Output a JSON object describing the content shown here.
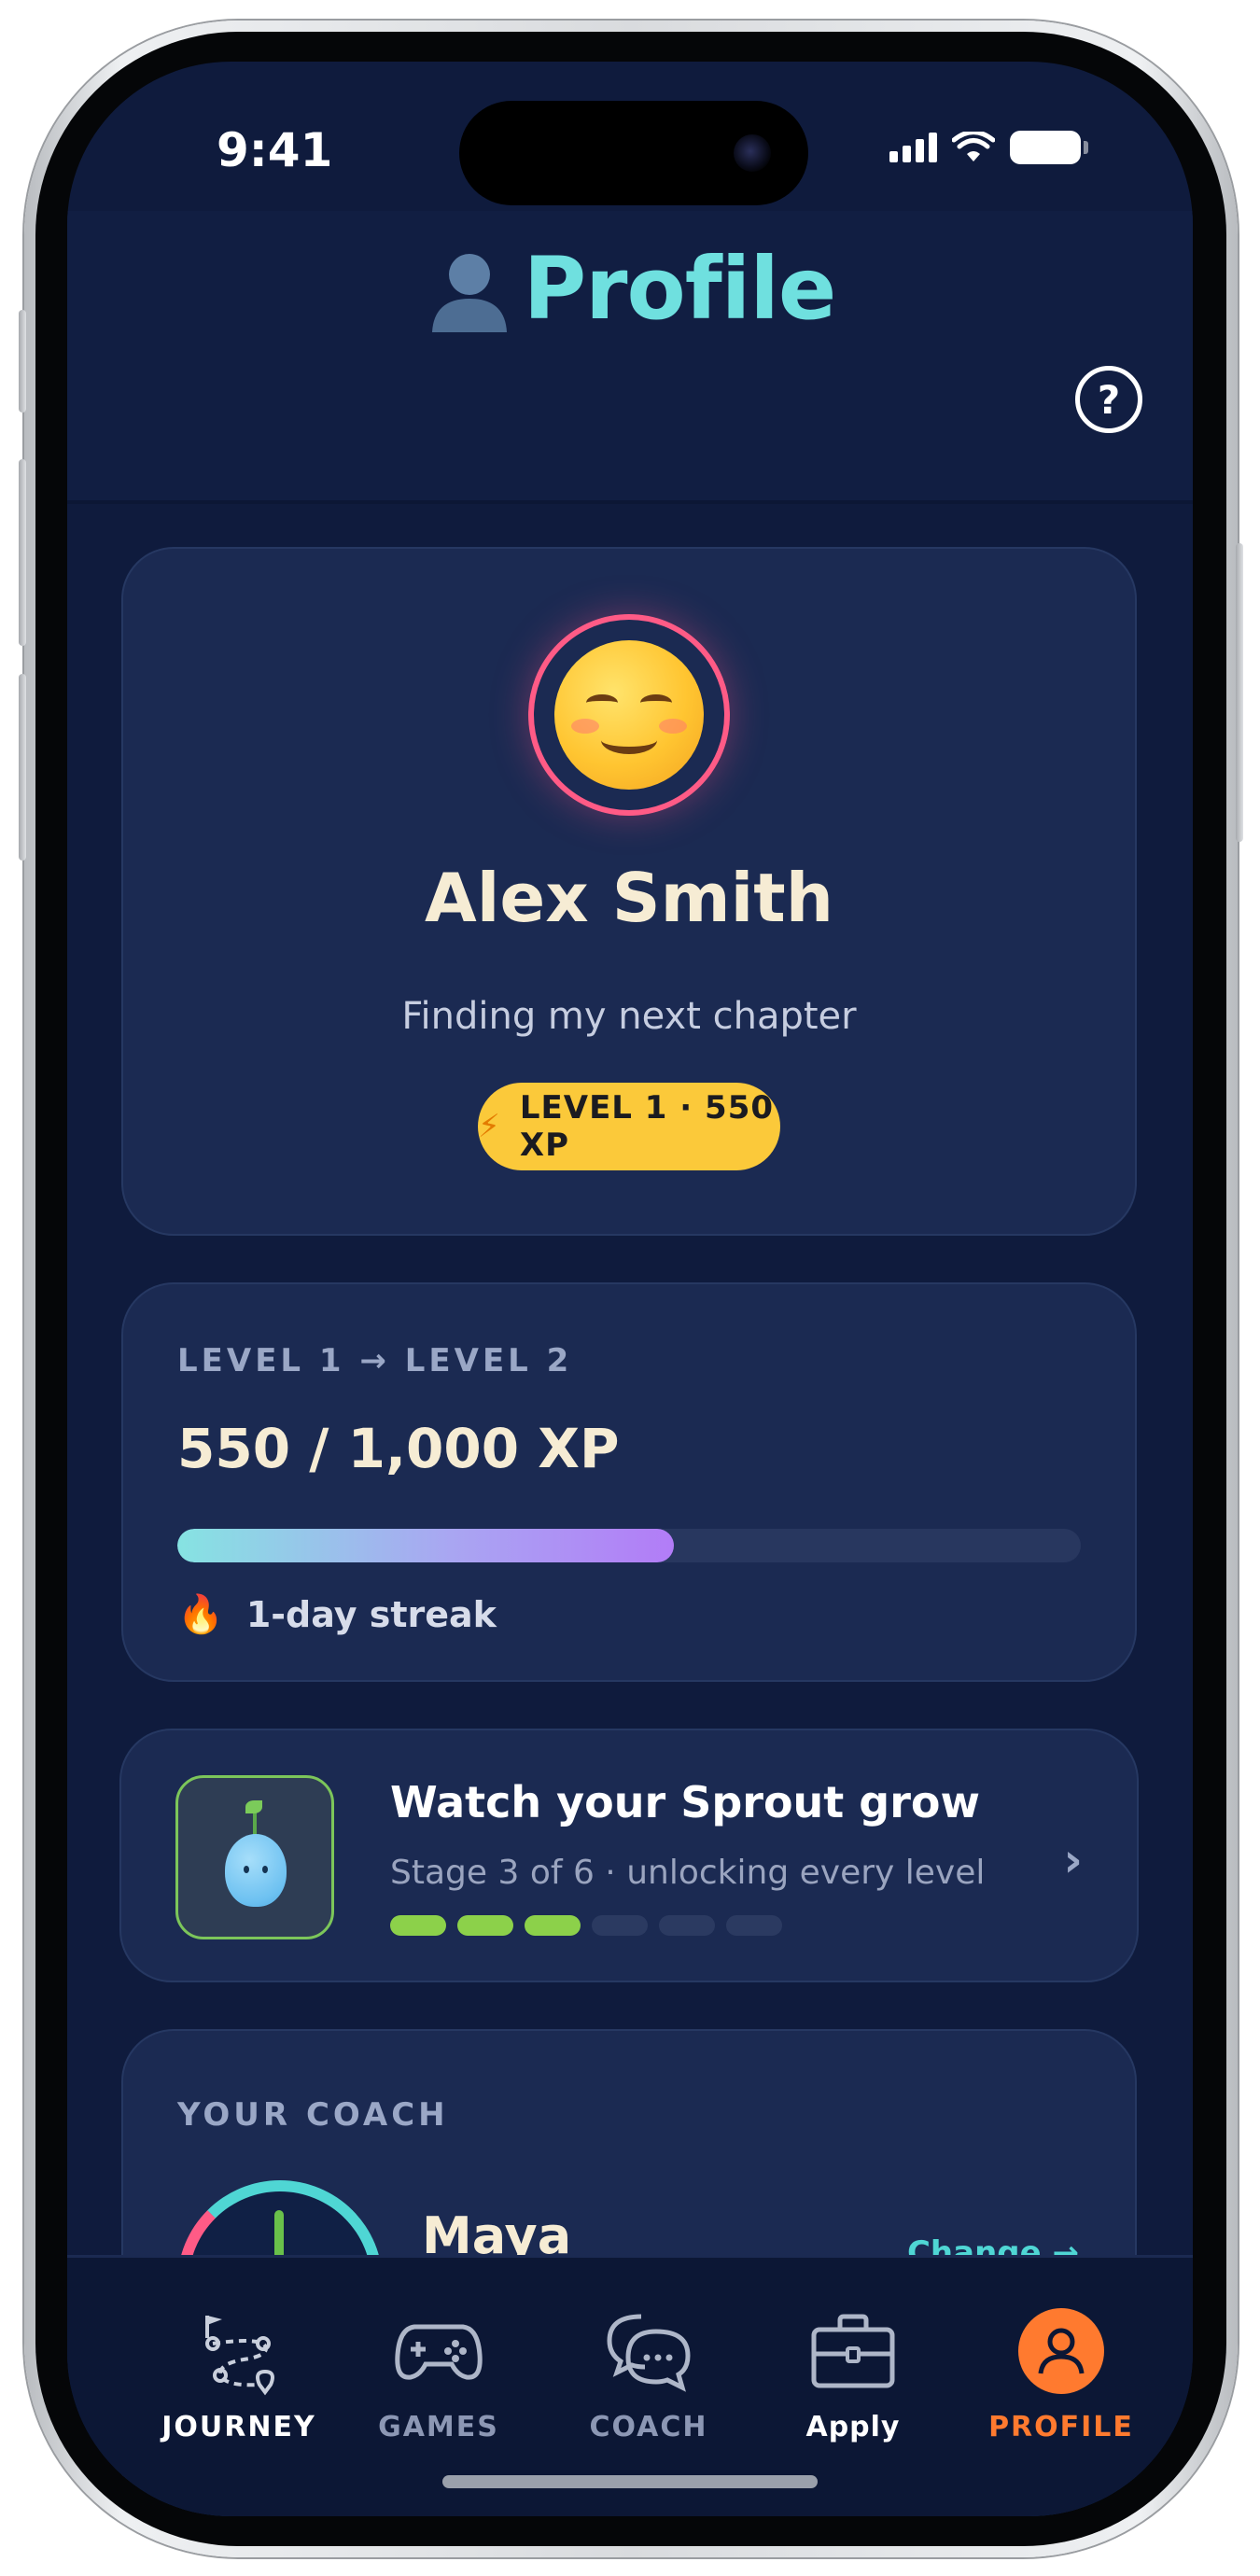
{
  "status_bar": {
    "time": "9:41",
    "icons": [
      "signal-icon",
      "wifi-icon",
      "battery-icon"
    ]
  },
  "header": {
    "icon": "person-icon",
    "title": "Profile",
    "help_label": "?"
  },
  "profile": {
    "avatar": "smiling-face-emoji",
    "name": "Alex Smith",
    "tagline": "Finding my next chapter",
    "level_badge": "LEVEL 1 · 550 XP"
  },
  "xp": {
    "kicker": "LEVEL 1 → LEVEL 2",
    "value_text": "550 / 1,000 XP",
    "progress_fraction": 0.55,
    "streak": "1-day streak"
  },
  "sprout": {
    "title": "Watch your Sprout grow",
    "subtitle": "Stage 3 of 6 · unlocking every level",
    "stages_total": 6,
    "stages_done": 3
  },
  "coach": {
    "kicker": "YOUR COACH",
    "name": "Maya",
    "change_label": "Change →"
  },
  "tabs": [
    {
      "label": "JOURNEY",
      "icon": "journey-map-icon"
    },
    {
      "label": "GAMES",
      "icon": "gamepad-icon"
    },
    {
      "label": "COACH",
      "icon": "chat-bubbles-icon"
    },
    {
      "label": "Apply",
      "icon": "briefcase-icon"
    },
    {
      "label": "PROFILE",
      "icon": "profile-icon",
      "active": true
    }
  ],
  "colors": {
    "background": "#0f1b3d",
    "title_accent": "#6fe0df",
    "badge": "#fbc93a",
    "active_tab": "#ff7a2f",
    "sprout_progress": "#8cd14a"
  }
}
